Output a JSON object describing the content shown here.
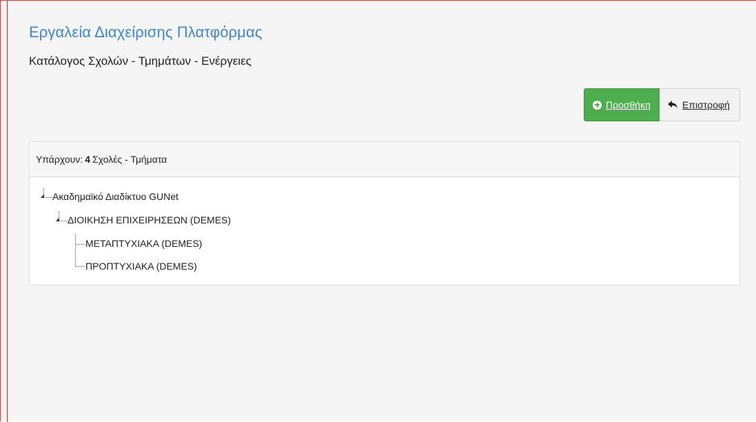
{
  "header": {
    "title": "Εργαλεία Διαχείρισης Πλατφόρμας",
    "subtitle": "Κατάλογος Σχολών - Τμημάτων - Ενέργειες"
  },
  "toolbar": {
    "add_label": "Προσθήκη",
    "back_label": "Επιστροφή",
    "add_color": "#4cae4c"
  },
  "panel": {
    "count_prefix": "Υπάρχουν:",
    "count": "4",
    "count_suffix": "Σχολές - Τμήματα"
  },
  "tree": {
    "root": "Ακαδημαϊκό Διαδίκτυο GUNet",
    "child": "ΔΙΟΙΚΗΣΗ ΕΠΙΧΕΙΡΗΣΕΩΝ (DEMES)",
    "leaves": [
      "ΜΕΤΑΠΤΥΧΙΑΚΑ (DEMES)",
      "ΠΡΟΠΤΥΧΙΑΚΑ (DEMES)"
    ]
  }
}
